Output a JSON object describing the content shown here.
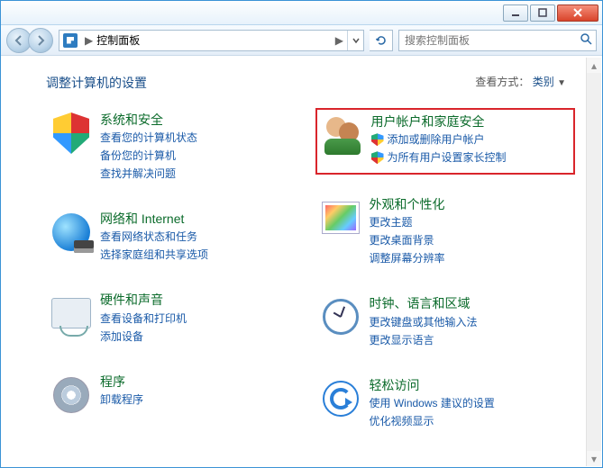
{
  "titlebar": {},
  "nav": {
    "location": "控制面板",
    "sep": "▶",
    "search_placeholder": "搜索控制面板"
  },
  "header": {
    "title": "调整计算机的设置",
    "viewby_label": "查看方式：",
    "viewby_value": "类别",
    "viewby_arrow": "▼"
  },
  "left": [
    {
      "title": "系统和安全",
      "links": [
        "查看您的计算机状态",
        "备份您的计算机",
        "查找并解决问题"
      ]
    },
    {
      "title": "网络和 Internet",
      "links": [
        "查看网络状态和任务",
        "选择家庭组和共享选项"
      ]
    },
    {
      "title": "硬件和声音",
      "links": [
        "查看设备和打印机",
        "添加设备"
      ]
    },
    {
      "title": "程序",
      "links": [
        "卸载程序"
      ]
    }
  ],
  "right": [
    {
      "title": "用户帐户和家庭安全",
      "links": [
        "添加或删除用户帐户",
        "为所有用户设置家长控制"
      ],
      "shields": [
        true,
        true
      ],
      "highlight": true
    },
    {
      "title": "外观和个性化",
      "links": [
        "更改主题",
        "更改桌面背景",
        "调整屏幕分辨率"
      ]
    },
    {
      "title": "时钟、语言和区域",
      "links": [
        "更改键盘或其他输入法",
        "更改显示语言"
      ]
    },
    {
      "title": "轻松访问",
      "links": [
        "使用 Windows 建议的设置",
        "优化视频显示"
      ]
    }
  ]
}
